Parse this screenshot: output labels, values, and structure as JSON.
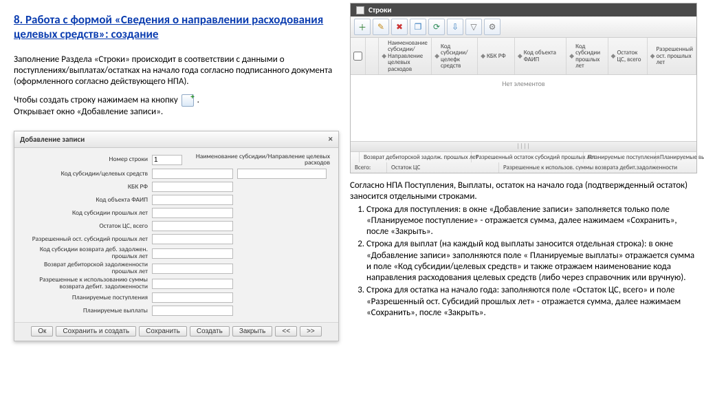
{
  "title": "8. Работа с формой «Сведения о направлении расходования целевых средств»: создание",
  "left_para1": "Заполнение Раздела «Строки» происходит в соответствии с данными о поступлениях/выплатах/остатках на начало года согласно подписанного документа (оформленного согласно действующего НПА).",
  "left_para2_a": "Чтобы создать строку нажимаем на кнопку",
  "left_para2_b": ".",
  "left_para3": "Открывает окно «Добавление записи».",
  "dialog": {
    "title": "Добавление записи",
    "row_number_label": "Номер строки",
    "row_number_value": "1",
    "name_subsidy_label": "Наименование субсидии/Направление целевых расходов",
    "fields": {
      "f1": "Код субсидии/целевых средств",
      "f2": "КБК РФ",
      "f3": "Код объекта ФАИП",
      "f4": "Код субсидии прошлых лет",
      "f5": "Остаток ЦС, всего",
      "f6": "Разрешенный ост. субсидий прошлых лет",
      "f7": "Код субсидии возврата деб. задолжен. прошлых лет",
      "f8": "Возврат дебиторской задолженности прошлых лет",
      "f9": "Разрешенные к использованию суммы возврата дебит. задолженности",
      "f10": "Планируемые поступления",
      "f11": "Планируемые выплаты"
    },
    "buttons": {
      "ok": "Ок",
      "save_create": "Сохранить и создать",
      "save": "Сохранить",
      "create": "Создать",
      "close": "Закрыть",
      "prev": "<<",
      "next": ">>"
    }
  },
  "panel": {
    "title": "Строки",
    "columns": {
      "c1": "Наименование субсидии/Направление целевых расходов",
      "c2": "Код субсидии/целефк средств",
      "c3": "КБК РФ",
      "c4": "Код объекта ФАИП",
      "c5": "Код субсидии прошлых лет",
      "c6": "Остаток ЦС, всего",
      "c7": "Разрешенный ост. прошлых лет"
    },
    "empty": "Нет элементов",
    "footer": {
      "total": "Всего:",
      "r1c1": "Возврат дебиторской задолж. прошлых лет",
      "r1c2": "Разрешенный остаток субсидий прошлых лет",
      "r1c3": "Планируемые поступления",
      "r1c4": "Планируемые выплаты",
      "r2c1": "Остаток ЦС",
      "r2c2": "Разрешенные к использов. суммы возврата дебит.задолженности"
    }
  },
  "right_intro": "Согласно НПА Поступления, Выплаты, остаток на начало года (подтвержденный остаток) заносится отдельными строками.",
  "right_items": {
    "i1": "Строка для поступления: в окне «Добавление записи» заполняется только поле «Планируемое поступление» - отражается сумма, далее нажимаем «Сохранить», после «Закрыть».",
    "i2": "Строка для выплат (на каждый код выплаты заносится отдельная строка): в окне «Добавление записи» заполняются поле « Планируемые выплаты» отражается сумма и поле «Код субсидии/целевых средств» и также отражаем наименование кода направления расходования целевых средств (либо через справочник или вручную).",
    "i3": "Строка для остатка на начало года: заполняются поле «Остаток ЦС, всего» и поле «Разрешенный ост. Субсидий прошлых лет» - отражается сумма, далее нажимаем «Сохранить», после «Закрыть»."
  }
}
